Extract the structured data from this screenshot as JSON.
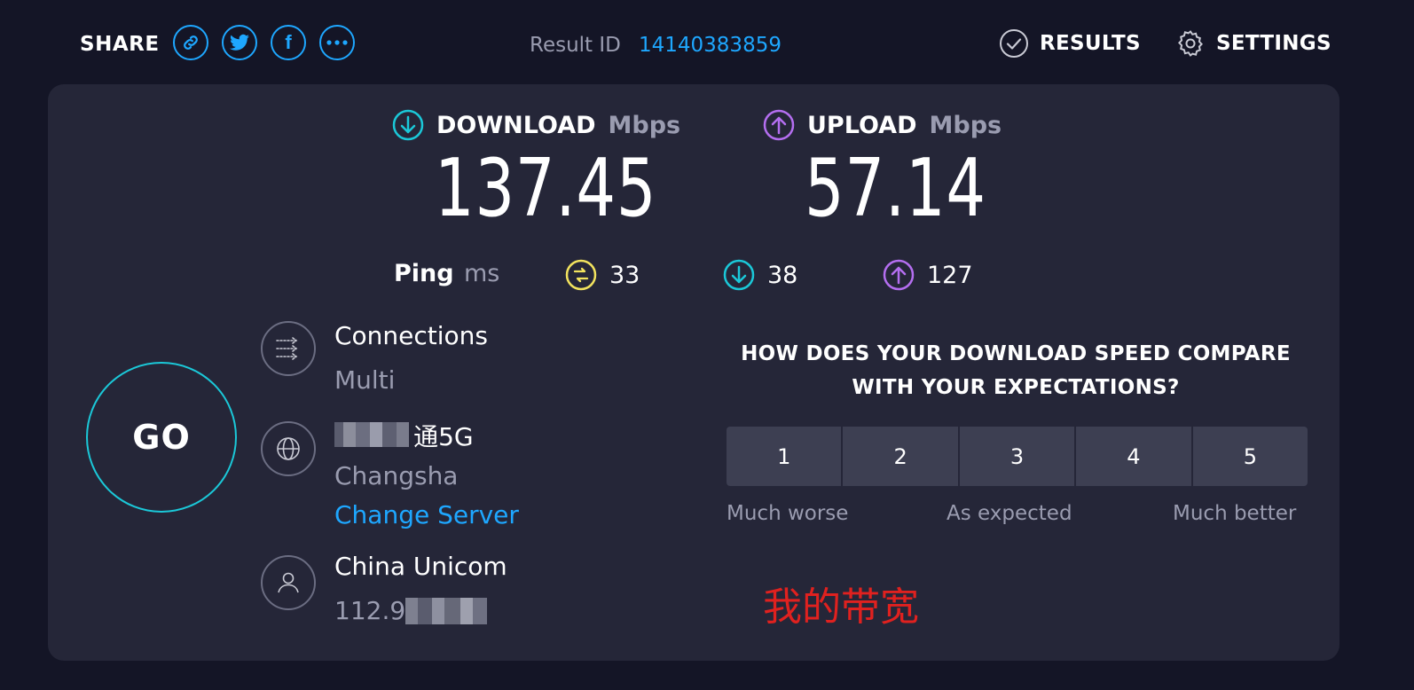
{
  "header": {
    "share_label": "SHARE",
    "share_icons": [
      "link-icon",
      "twitter-icon",
      "facebook-icon",
      "more-icon"
    ],
    "result_label": "Result ID",
    "result_id": "14140383859",
    "results_label": "RESULTS",
    "settings_label": "SETTINGS"
  },
  "download": {
    "label": "DOWNLOAD",
    "unit": "Mbps",
    "value": "137.45",
    "icon": "download-arrow-icon",
    "color": "#1bc8d8"
  },
  "upload": {
    "label": "UPLOAD",
    "unit": "Mbps",
    "value": "57.14",
    "icon": "upload-arrow-icon",
    "color": "#b46ef0"
  },
  "ping": {
    "label": "Ping",
    "unit": "ms",
    "idle": "33",
    "download": "38",
    "upload": "127",
    "idle_color": "#f2e35e"
  },
  "go_label": "GO",
  "connections": {
    "title": "Connections",
    "value": "Multi"
  },
  "server": {
    "name": "通5G",
    "city": "Changsha",
    "change_label": "Change Server"
  },
  "provider": {
    "name": "China Unicom",
    "ip": "112.9"
  },
  "survey": {
    "question_line1": "HOW DOES YOUR DOWNLOAD SPEED COMPARE",
    "question_line2": "WITH YOUR EXPECTATIONS?",
    "options": [
      "1",
      "2",
      "3",
      "4",
      "5"
    ],
    "scale_low": "Much worse",
    "scale_mid": "As expected",
    "scale_high": "Much better"
  },
  "annotation": "我的带宽",
  "accent_color": "#1ea7ff"
}
